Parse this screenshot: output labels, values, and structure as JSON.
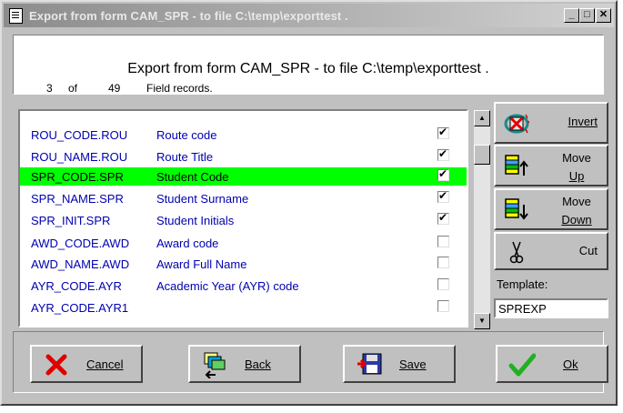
{
  "window": {
    "title": "Export from form CAM_SPR - to file C:\\temp\\exporttest .",
    "min_glyph": "_",
    "max_glyph": "□",
    "close_glyph": "✕"
  },
  "header": {
    "title": "Export from form CAM_SPR - to file C:\\temp\\exporttest .",
    "current": "3",
    "of_label": "of",
    "total": "49",
    "suffix": "Field records."
  },
  "fields": [
    {
      "code": "ROU_CODE.ROU",
      "desc": "Route code",
      "checked": true,
      "selected": false
    },
    {
      "code": "ROU_NAME.ROU",
      "desc": "Route Title",
      "checked": true,
      "selected": false
    },
    {
      "code": "SPR_CODE.SPR",
      "desc": "Student Code",
      "checked": true,
      "selected": true
    },
    {
      "code": "SPR_NAME.SPR",
      "desc": "Student Surname",
      "checked": true,
      "selected": false
    },
    {
      "code": "SPR_INIT.SPR",
      "desc": "Student Initials",
      "checked": true,
      "selected": false
    },
    {
      "code": "AWD_CODE.AWD",
      "desc": "Award code",
      "checked": false,
      "selected": false
    },
    {
      "code": "AWD_NAME.AWD",
      "desc": "Award Full Name",
      "checked": false,
      "selected": false
    },
    {
      "code": "AYR_CODE.AYR",
      "desc": "Academic Year (AYR) code",
      "checked": false,
      "selected": false
    },
    {
      "code": "AYR_CODE.AYR1",
      "desc": "",
      "checked": false,
      "selected": false
    }
  ],
  "side": {
    "invert_label": "Invert",
    "move_up_line1": "Move",
    "move_up_line2": "Up",
    "move_down_line1": "Move",
    "move_down_line2": "Down",
    "cut_label": "Cut",
    "template_label": "Template:",
    "template_value": "SPREXP"
  },
  "buttons": {
    "cancel": "Cancel",
    "back": "Back",
    "save": "Save",
    "ok": "Ok"
  },
  "colors": {
    "selected_row": "#00ff00",
    "field_text": "#0000b0",
    "face": "#c0c0c0"
  }
}
